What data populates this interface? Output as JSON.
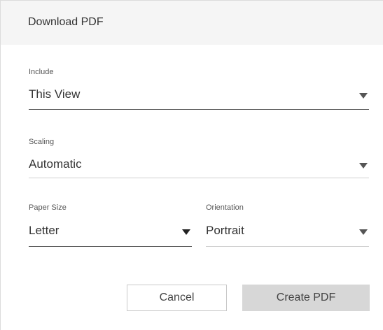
{
  "dialog": {
    "title": "Download PDF"
  },
  "fields": {
    "include": {
      "label": "Include",
      "value": "This View",
      "icon": "caret-down-icon"
    },
    "scaling": {
      "label": "Scaling",
      "value": "Automatic",
      "icon": "caret-down-icon"
    },
    "paper_size": {
      "label": "Paper Size",
      "value": "Letter",
      "icon": "caret-down-icon"
    },
    "orientation": {
      "label": "Orientation",
      "value": "Portrait",
      "icon": "caret-down-icon"
    }
  },
  "actions": {
    "cancel_label": "Cancel",
    "create_label": "Create PDF"
  },
  "colors": {
    "header_bg": "#f5f5f5",
    "primary_button_bg": "#d7d7d7",
    "text": "#333333"
  }
}
